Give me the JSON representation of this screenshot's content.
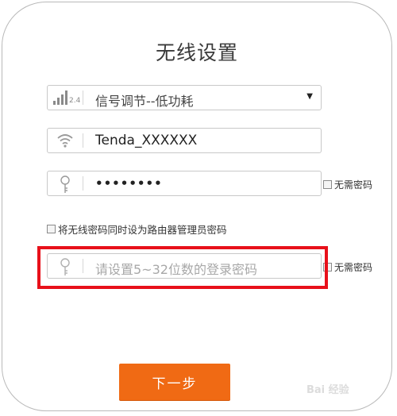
{
  "title": "无线设置",
  "signal": {
    "selected": "信号调节--低功耗",
    "icon": "signal-strength-icon",
    "band_label": "2.4"
  },
  "ssid": {
    "value": "Tenda_XXXXXX",
    "icon": "wifi-icon"
  },
  "wifi_password": {
    "value": "••••••••",
    "icon": "key-icon",
    "no_password_label": "无需密码"
  },
  "same_as_admin_label": "将无线密码同时设为路由器管理员密码",
  "admin_password": {
    "placeholder": "请设置5~32位数的登录密码",
    "icon": "key-icon",
    "no_password_label": "无需密码"
  },
  "next_button": "下一步",
  "watermark": "Bai 经验",
  "colors": {
    "accent": "#f06a14",
    "highlight": "#e8101a"
  }
}
